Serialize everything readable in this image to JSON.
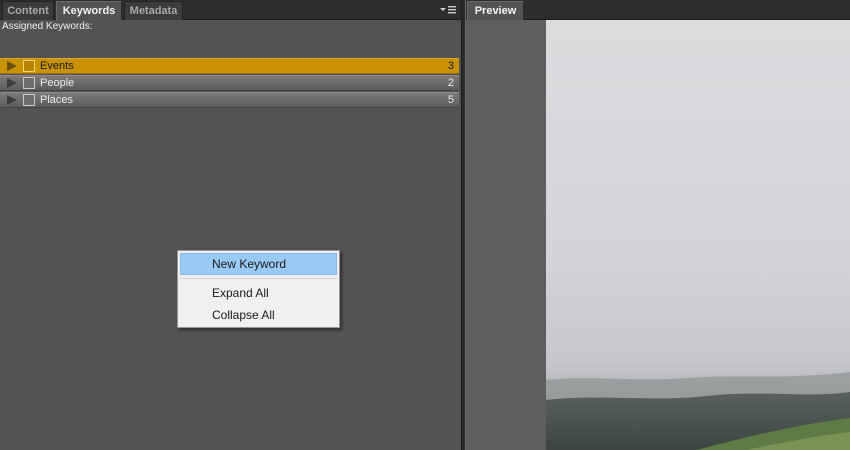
{
  "left_panel": {
    "tabs": [
      {
        "label": "Content",
        "active": false
      },
      {
        "label": "Keywords",
        "active": true
      },
      {
        "label": "Metadata",
        "active": false
      }
    ],
    "menu_icon": "panel-menu-icon",
    "assigned_label": "Assigned Keywords:",
    "keywords": [
      {
        "label": "Events",
        "count": "3",
        "selected": true
      },
      {
        "label": "People",
        "count": "2",
        "selected": false
      },
      {
        "label": "Places",
        "count": "5",
        "selected": false
      }
    ]
  },
  "right_panel": {
    "tabs": [
      {
        "label": "Preview",
        "active": true
      }
    ]
  },
  "context_menu": {
    "items": [
      {
        "label": "New Keyword",
        "highlighted": true
      },
      {
        "label": "Expand All",
        "highlighted": false
      },
      {
        "label": "Collapse All",
        "highlighted": false
      }
    ]
  },
  "colors": {
    "selection": "#c89204",
    "menu_highlight": "#99c9f5",
    "panel_bg": "#535353"
  }
}
